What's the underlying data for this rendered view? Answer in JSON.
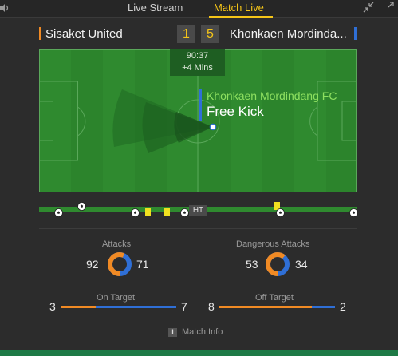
{
  "tabs": {
    "live_stream": "Live Stream",
    "match_live": "Match Live"
  },
  "match": {
    "home_team": "Sisaket United",
    "away_team": "Khonkaen Mordindang FC",
    "away_team_display": "Khonkaen Mordinda...",
    "home_score": "1",
    "away_score": "5",
    "home_color": "#f08a24",
    "away_color": "#2f6fd6"
  },
  "clock": {
    "time": "90:37",
    "added": "+4 Mins"
  },
  "event": {
    "team": "Khonkaen Mordindang FC",
    "name": "Free Kick"
  },
  "timeline": {
    "ht_label": "HT",
    "events": [
      {
        "type": "goal",
        "team": "home"
      },
      {
        "type": "goal",
        "team": "away"
      },
      {
        "type": "goal",
        "team": "home"
      },
      {
        "type": "yellow-card",
        "team": "away"
      },
      {
        "type": "yellow-card",
        "team": "away"
      },
      {
        "type": "goal",
        "team": "home"
      },
      {
        "type": "yellow-card",
        "team": "away"
      },
      {
        "type": "goal",
        "team": "home"
      },
      {
        "type": "goal",
        "team": "home"
      }
    ]
  },
  "stats": {
    "attacks": {
      "label": "Attacks",
      "home": "92",
      "away": "71"
    },
    "dangerous_attacks": {
      "label": "Dangerous Attacks",
      "home": "53",
      "away": "34"
    },
    "on_target": {
      "label": "On Target",
      "home": "3",
      "away": "7"
    },
    "off_target": {
      "label": "Off Target",
      "home": "8",
      "away": "2"
    }
  },
  "footer": {
    "match_info": "Match Info"
  },
  "icons": [
    "volume-icon",
    "collapse-icon",
    "expand-icon",
    "football-icon",
    "yellow-card-icon",
    "info-icon"
  ]
}
